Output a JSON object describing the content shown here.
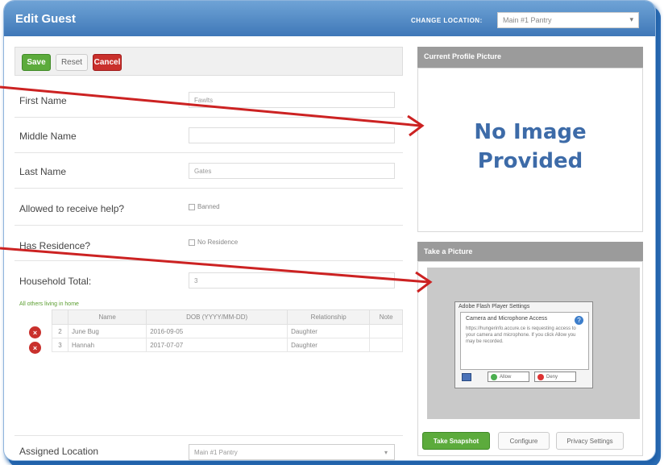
{
  "header": {
    "title": "Edit Guest",
    "change_location_label": "CHANGE LOCATION:",
    "location_value": "Main #1 Pantry"
  },
  "toolbar": {
    "save_label": "Save",
    "reset_label": "Reset",
    "cancel_label": "Cancel"
  },
  "form": {
    "first_name_label": "First Name",
    "first_name_value": "Fawlts",
    "middle_name_label": "Middle Name",
    "middle_name_value": "",
    "last_name_label": "Last Name",
    "last_name_value": "Gates",
    "allowed_label": "Allowed to receive help?",
    "allowed_option": "Banned",
    "residence_label": "Has Residence?",
    "residence_option": "No Residence",
    "household_label": "Household Total:",
    "household_value": "3",
    "household_note": "All others living in home",
    "members_headers": [
      "Name",
      "DOB (YYYY/MM-DD)",
      "Relationship",
      "Note"
    ],
    "members": [
      {
        "num": "2",
        "name": "June Bug",
        "dob": "2016-09-05",
        "relationship": "Daughter",
        "note": ""
      },
      {
        "num": "3",
        "name": "Hannah",
        "dob": "2017-07-07",
        "relationship": "Daughter",
        "note": ""
      }
    ],
    "assigned_label": "Assigned Location",
    "assigned_value": "Main #1 Pantry"
  },
  "profile": {
    "heading": "Current Profile Picture",
    "no_image_line1": "No Image",
    "no_image_line2": "Provided"
  },
  "camera": {
    "heading": "Take a Picture",
    "flash_title": "Adobe Flash Player Settings",
    "flash_heading": "Camera and Microphone Access",
    "flash_text": "https://hungerinfo.accure.ce is requesting access to your camera and microphone. If you click Allow you may be recorded.",
    "allow_label": "Allow",
    "deny_label": "Deny",
    "snapshot_label": "Take Snapshot",
    "configure_label": "Configure",
    "privacy_label": "Privacy Settings"
  },
  "colors": {
    "header_blue": "#3f78b8",
    "accent_green": "#5cab3c",
    "danger_red": "#c9302c",
    "arrow_red": "#cc2222"
  }
}
